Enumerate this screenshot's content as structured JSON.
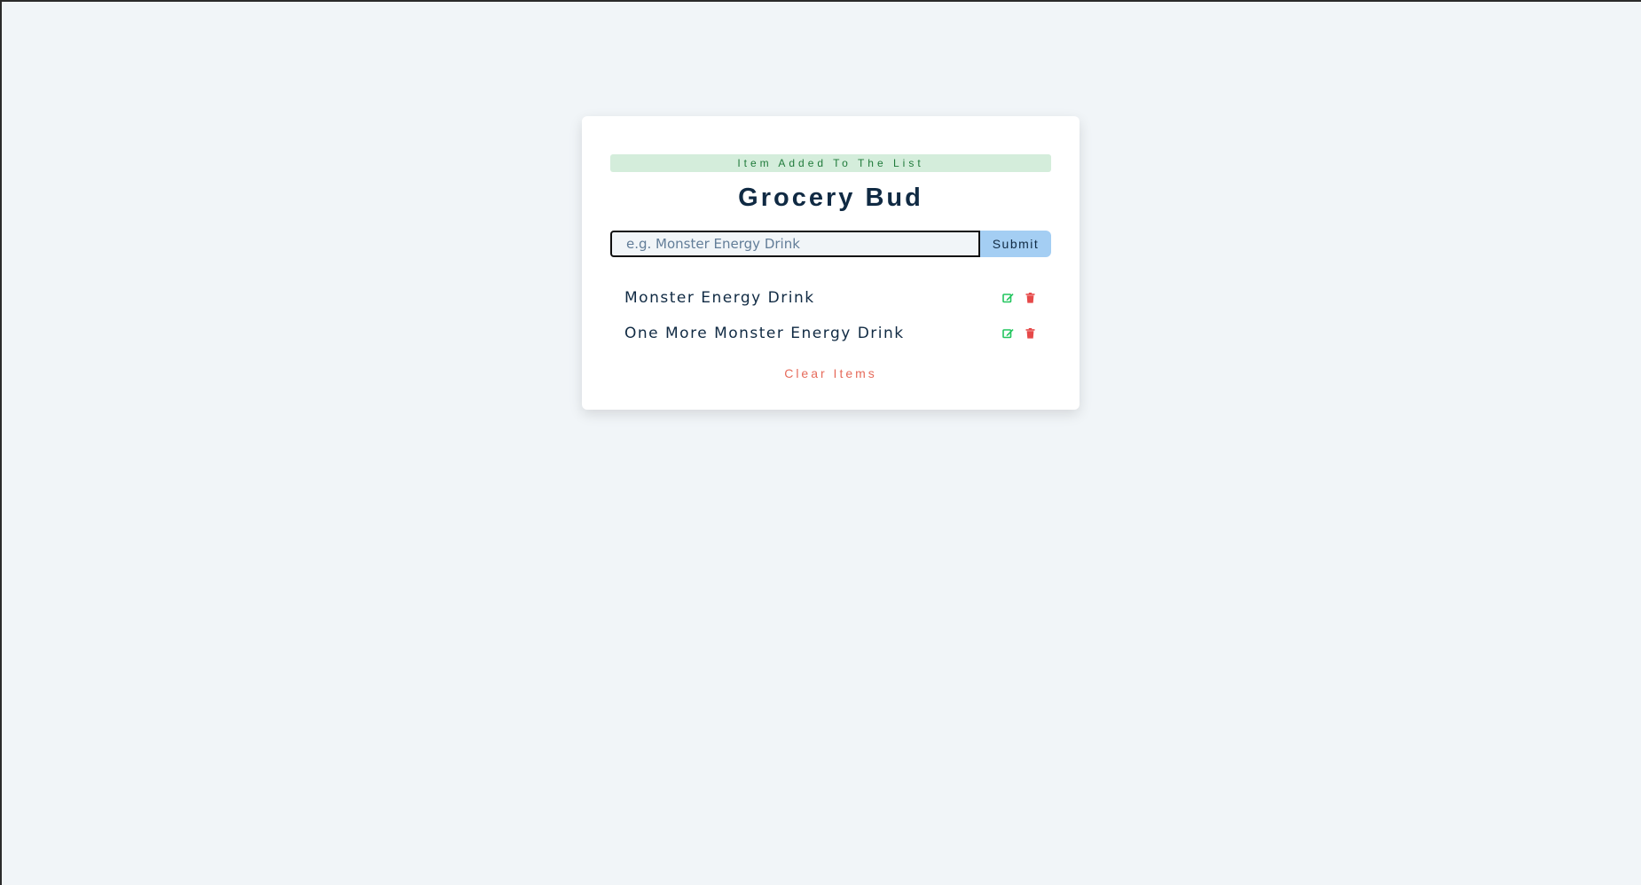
{
  "alert": {
    "text": "Item Added To The List"
  },
  "app": {
    "title": "Grocery Bud"
  },
  "form": {
    "placeholder": "e.g. Monster Energy Drink",
    "value": "",
    "submit_label": "Submit"
  },
  "items": [
    {
      "title": "Monster Energy Drink"
    },
    {
      "title": "One More Monster Energy Drink"
    }
  ],
  "icons": {
    "edit": "edit-icon",
    "delete": "trash-icon"
  },
  "colors": {
    "background": "#f1f5f8",
    "alert_bg": "#d4eddb",
    "alert_text": "#1f7a3a",
    "title": "#102a43",
    "submit_bg": "#a4cef3",
    "edit": "#22c55e",
    "delete": "#e64949",
    "clear": "#e66b5b"
  },
  "clear_label": "Clear Items"
}
